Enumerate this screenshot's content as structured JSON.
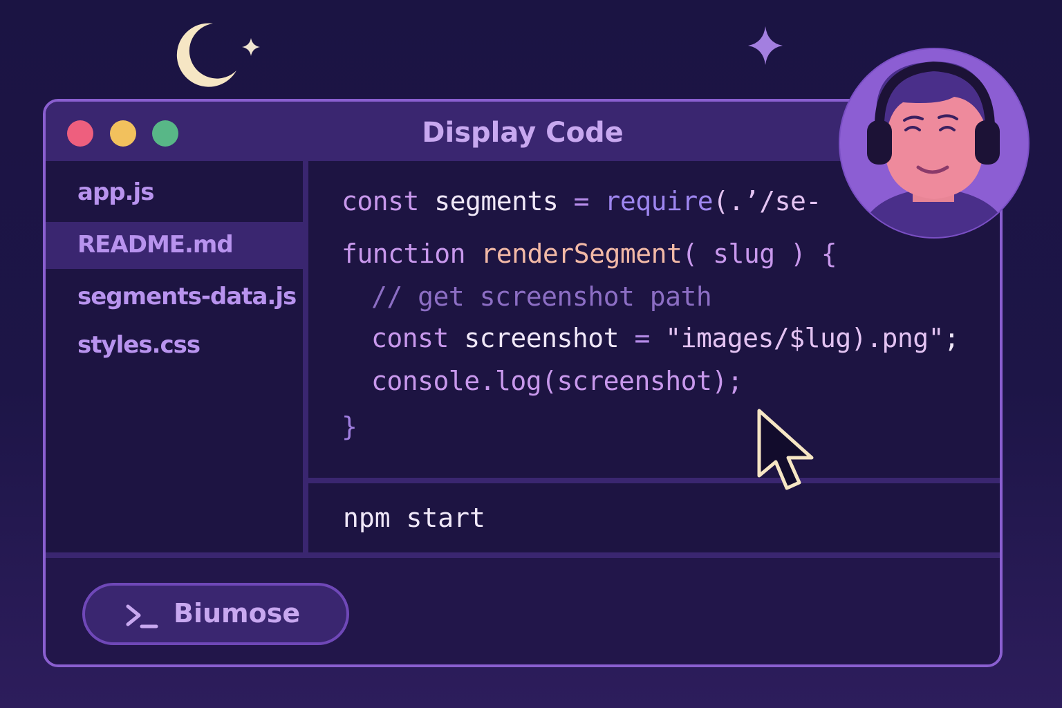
{
  "window": {
    "title": "Display Code",
    "controls": {
      "close_icon": "close-dot",
      "minimize_icon": "minimize-dot",
      "maximize_icon": "maximize-dot"
    }
  },
  "sidebar": {
    "files": [
      {
        "name": "app.js"
      },
      {
        "name": "README.md",
        "selected": true
      },
      {
        "name": "segments-data.js"
      },
      {
        "name": "styles.css"
      }
    ]
  },
  "editor": {
    "lines": [
      [
        "const",
        " segments",
        " = ",
        "require",
        "(.’/se-"
      ],
      [
        "function",
        " ",
        "renderSegment",
        "( slug ) {"
      ],
      [
        "// get screenshot path"
      ],
      [
        "const",
        " screenshot",
        " = ",
        "\"images/$lug).png\"",
        ";"
      ],
      [
        "console.log",
        "(screenshot);"
      ],
      [
        "}"
      ]
    ]
  },
  "terminal": {
    "command": "npm start"
  },
  "run_button": {
    "label": "Biumose",
    "icon": "terminal-prompt-icon"
  },
  "decorations": {
    "moon_icon": "crescent-moon-icon",
    "star_icon": "sparkle-star-icon",
    "avatar": "headphones-user-avatar",
    "cursor": "mouse-pointer-icon"
  },
  "colors": {
    "background": "#1b1443",
    "accent": "#8a5fd0",
    "panel": "#3a2670"
  }
}
